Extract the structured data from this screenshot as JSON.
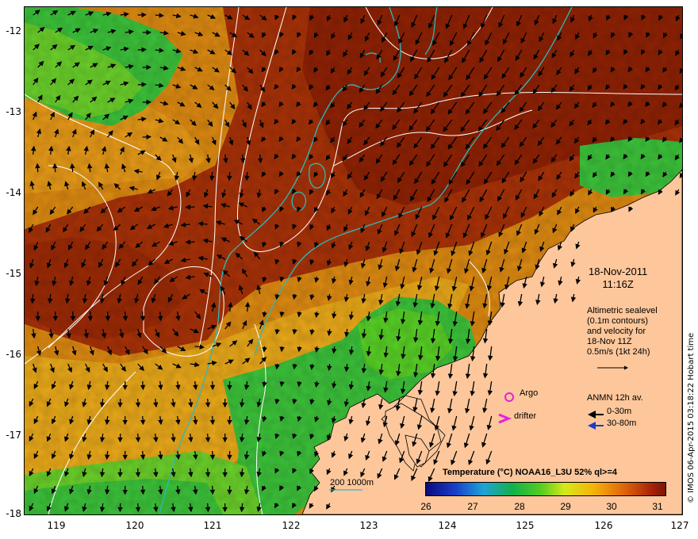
{
  "map": {
    "y_ticks": [
      "-12",
      "-13",
      "-14",
      "-15",
      "-16",
      "-17",
      "-18"
    ],
    "x_ticks": [
      "119",
      "120",
      "121",
      "122",
      "123",
      "124",
      "125",
      "126",
      "127"
    ],
    "lon_range": [
      118.6,
      127.0
    ],
    "lat_range": [
      -11.8,
      -18.0
    ],
    "colors": {
      "land": "#fdc79b",
      "warm_sst": "#a83208",
      "mid_sst": "#d77a10",
      "cool_sst": "#35c034",
      "contour_white": "#ffffff",
      "isobath_cyan": "#2fb8b8",
      "argo_magenta": "#e81ee0",
      "current_blue": "#1a3cc8"
    }
  },
  "annotations": {
    "date": "18-Nov-2011",
    "time": "11:16Z",
    "alti_line1": "Altimetric sealevel",
    "alti_line2": "(0.1m contours)",
    "alti_line3": "and velocity for",
    "alti_line4": "18-Nov 11Z",
    "alti_line5": "0.5m/s (1kt 24h)",
    "argo": "Argo",
    "drifter": "drifter",
    "anmn_title": "ANMN 12h av.",
    "anmn_0": "0-30m",
    "anmn_1": "30-80m",
    "depth_legend": "200  1000m"
  },
  "colorbar": {
    "title": "Temperature (°C) NOAA16_L3U 52% ql>=4",
    "ticks": [
      "26",
      "27",
      "28",
      "29",
      "30",
      "31"
    ]
  },
  "credit": "© IMOS 06-Apr-2015 03:18:22 Hobart time"
}
